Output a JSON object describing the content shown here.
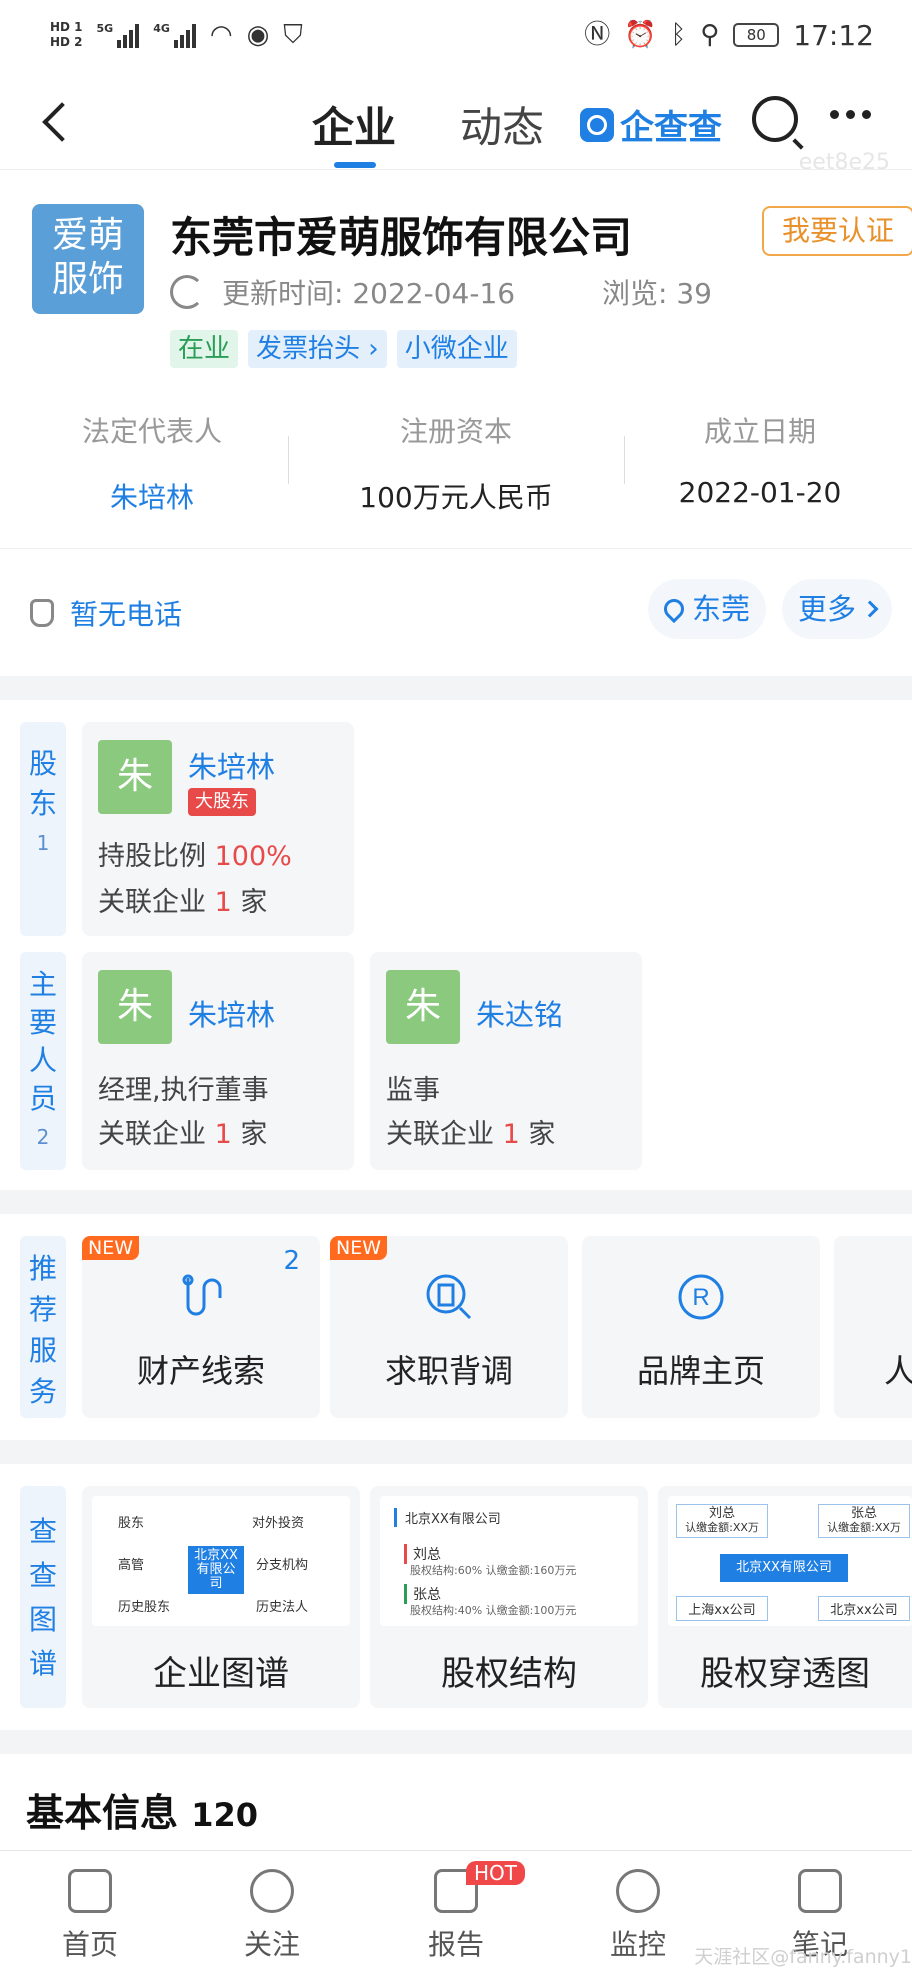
{
  "status": {
    "hd1": "HD 1",
    "hd2": "HD 2",
    "net1": "5G",
    "net2": "4G",
    "battery": "80",
    "time": "17:12"
  },
  "nav": {
    "tab_company": "企业",
    "tab_dynamic": "动态",
    "brand": "企查查",
    "watermark": "eet8e25"
  },
  "company": {
    "logo_line1": "爱萌",
    "logo_line2": "服饰",
    "name": "东莞市爱萌服饰有限公司",
    "certify": "我要认证",
    "update_label": "更新时间:",
    "update_date": "2022-04-16",
    "views": "浏览: 39",
    "tags": [
      "在业",
      "发票抬头",
      "小微企业"
    ],
    "legal_rep_label": "法定代表人",
    "legal_rep": "朱培林",
    "capital_label": "注册资本",
    "capital": "100万元人民币",
    "founded_label": "成立日期",
    "founded": "2022-01-20",
    "phone": "暂无电话",
    "location": "东莞",
    "more": "更多"
  },
  "shareholders": {
    "label": "股东",
    "count": "1",
    "items": [
      {
        "avatar": "朱",
        "name": "朱培林",
        "badge": "大股东",
        "ratio_label": "持股比例",
        "ratio": "100%",
        "rel_label": "关联企业",
        "rel_count": "1",
        "rel_unit": "家"
      }
    ]
  },
  "staff": {
    "label": "主要人员",
    "count": "2",
    "items": [
      {
        "avatar": "朱",
        "name": "朱培林",
        "role": "经理,执行董事",
        "rel_label": "关联企业",
        "rel_count": "1",
        "rel_unit": "家"
      },
      {
        "avatar": "朱",
        "name": "朱达铭",
        "role": "监事",
        "rel_label": "关联企业",
        "rel_count": "1",
        "rel_unit": "家"
      }
    ]
  },
  "services": {
    "label": "推荐服务",
    "items": [
      {
        "name": "财产线索",
        "badge": "NEW",
        "count": "2"
      },
      {
        "name": "求职背调",
        "badge": "NEW"
      },
      {
        "name": "品牌主页"
      },
      {
        "name": "人"
      }
    ]
  },
  "graphs": {
    "label": "查查图谱",
    "items": [
      {
        "name": "企业图谱",
        "nodes": [
          "股东",
          "对外投资",
          "高管",
          "北京XX有限公司",
          "分支机构",
          "历史股东",
          "历史法人"
        ]
      },
      {
        "name": "股权结构",
        "root": "北京XX有限公司",
        "rows": [
          {
            "who": "刘总",
            "detail": "股权结构:60%  认缴金额:160万元"
          },
          {
            "who": "张总",
            "detail": "股权结构:40%  认缴金额:100万元"
          }
        ]
      },
      {
        "name": "股权穿透图",
        "top_left": "刘总",
        "top_left_sub": "认缴金额:XX万",
        "top_right": "张总",
        "top_right_sub": "认缴金额:XX万",
        "center": "北京XX有限公司",
        "bottom_left": "上海xx公司",
        "bottom_right": "北京xx公司"
      }
    ]
  },
  "basic_info": {
    "title": "基本信息",
    "count": "120"
  },
  "tabbar": {
    "items": [
      "首页",
      "关注",
      "报告",
      "监控",
      "笔记"
    ],
    "hot": "HOT",
    "watermark": "天涯社区@fanny.fanny1"
  },
  "colors": {
    "accent": "#1f7fe3",
    "green": "#2a9d57",
    "red": "#e84a4a",
    "orange": "#ff6a1f"
  }
}
